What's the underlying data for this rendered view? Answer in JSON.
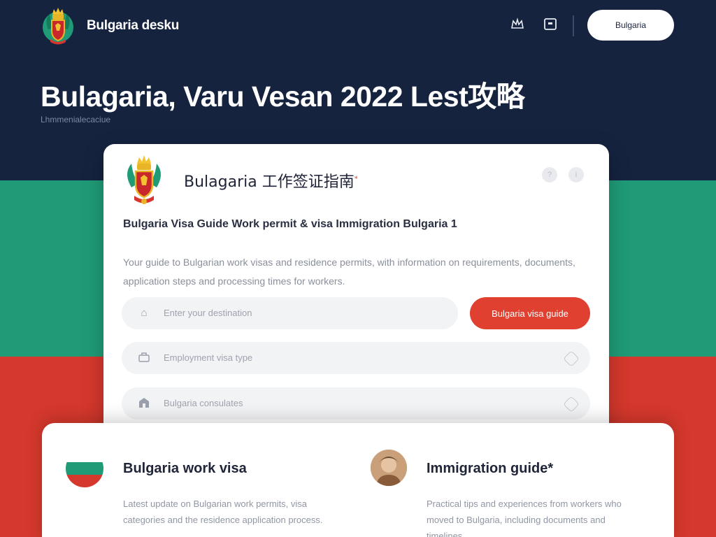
{
  "colors": {
    "navy": "#15233f",
    "green": "#1f9b77",
    "red": "#d5382c",
    "accent": "#e0402f",
    "white": "#ffffff"
  },
  "header": {
    "brand": "Bulgaria desku",
    "icons": [
      "crown-icon",
      "chat-icon"
    ],
    "button": "Bulgaria"
  },
  "hero": {
    "title": "Bulagaria, Varu Vesan 2022 Lest攻略",
    "subtitle": "Lhmmenialecaciue"
  },
  "card": {
    "title": "Bulagaria 工作签证指南",
    "title_badge": "*",
    "top_actions": [
      "?",
      "i"
    ],
    "tagline": "Bulgaria Visa Guide    Work permit & visa    Immigration Bulgaria 1",
    "description": "Your guide to Bulgarian work visas and residence permits, with information on requirements, documents, application steps and processing times for workers.",
    "search": {
      "placeholder": "Enter your destination",
      "button": "Bulgaria visa guide"
    },
    "options": [
      {
        "icon": "briefcase-icon",
        "label": "Employment visa type"
      },
      {
        "icon": "building-icon",
        "label": "Bulgaria consulates"
      }
    ]
  },
  "lower": {
    "left": {
      "title": "Bulgaria work visa",
      "text": "Latest update on Bulgarian work permits, visa categories and the residence application process."
    },
    "right": {
      "title": "Immigration guide*",
      "text": "Practical tips and experiences from workers who moved to Bulgaria, including documents and timelines."
    }
  }
}
